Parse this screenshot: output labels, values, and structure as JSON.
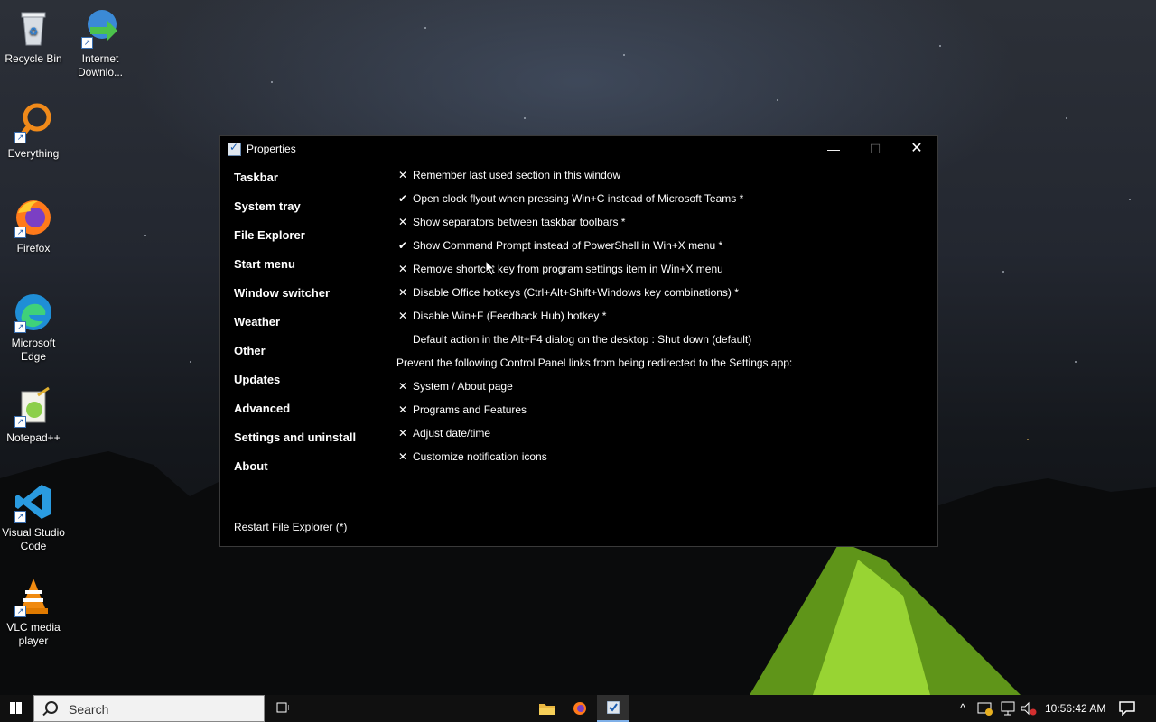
{
  "desktop": {
    "icons": [
      {
        "label": "Recycle Bin",
        "icon": "recycle-bin-icon"
      },
      {
        "label": "Internet Downlo...",
        "icon": "internet-download-manager-icon"
      },
      {
        "label": "Everything",
        "icon": "everything-search-icon"
      },
      {
        "label": "Firefox",
        "icon": "firefox-icon"
      },
      {
        "label": "Microsoft Edge",
        "icon": "edge-icon"
      },
      {
        "label": "Notepad++",
        "icon": "notepadpp-icon"
      },
      {
        "label": "Visual Studio Code",
        "icon": "vscode-icon"
      },
      {
        "label": "VLC media player",
        "icon": "vlc-icon"
      }
    ]
  },
  "window": {
    "title": "Properties",
    "controls": {
      "minimize": "—",
      "maximize": "☐",
      "close": "✕"
    },
    "nav": [
      {
        "label": "Taskbar",
        "active": false
      },
      {
        "label": "System tray",
        "active": false
      },
      {
        "label": "File Explorer",
        "active": false
      },
      {
        "label": "Start menu",
        "active": false
      },
      {
        "label": "Window switcher",
        "active": false
      },
      {
        "label": "Weather",
        "active": false
      },
      {
        "label": "Other",
        "active": true
      },
      {
        "label": "Updates",
        "active": false
      },
      {
        "label": "Advanced",
        "active": false
      },
      {
        "label": "Settings and uninstall",
        "active": false
      },
      {
        "label": "About",
        "active": false
      }
    ],
    "restart_link": "Restart File Explorer (*)",
    "options": [
      {
        "mark": "✕",
        "label": "Remember last used section in this window"
      },
      {
        "mark": "✔",
        "label": "Open clock flyout when pressing Win+C instead of Microsoft Teams *"
      },
      {
        "mark": "✕",
        "label": "Show separators between taskbar toolbars *"
      },
      {
        "mark": "✔",
        "label": "Show Command Prompt instead of PowerShell in Win+X menu *"
      },
      {
        "mark": "✕",
        "label": "Remove shortcut key from program settings item in Win+X menu"
      },
      {
        "mark": "✕",
        "label": "Disable Office hotkeys (Ctrl+Alt+Shift+Windows key combinations) *"
      },
      {
        "mark": "✕",
        "label": "Disable Win+F (Feedback Hub) hotkey *"
      },
      {
        "mark": "",
        "label": "Default action in the Alt+F4 dialog on the desktop : Shut down (default)"
      },
      {
        "mark": "",
        "label": "Prevent the following Control Panel links from being redirected to the Settings app:",
        "plain": true
      },
      {
        "mark": "✕",
        "label": "System / About page"
      },
      {
        "mark": "✕",
        "label": "Programs and Features"
      },
      {
        "mark": "✕",
        "label": "Adjust date/time"
      },
      {
        "mark": "✕",
        "label": "Customize notification icons"
      }
    ]
  },
  "taskbar": {
    "search_placeholder": "Search",
    "clock": "10:56:42 AM",
    "tray": {
      "chevron": "^"
    }
  }
}
